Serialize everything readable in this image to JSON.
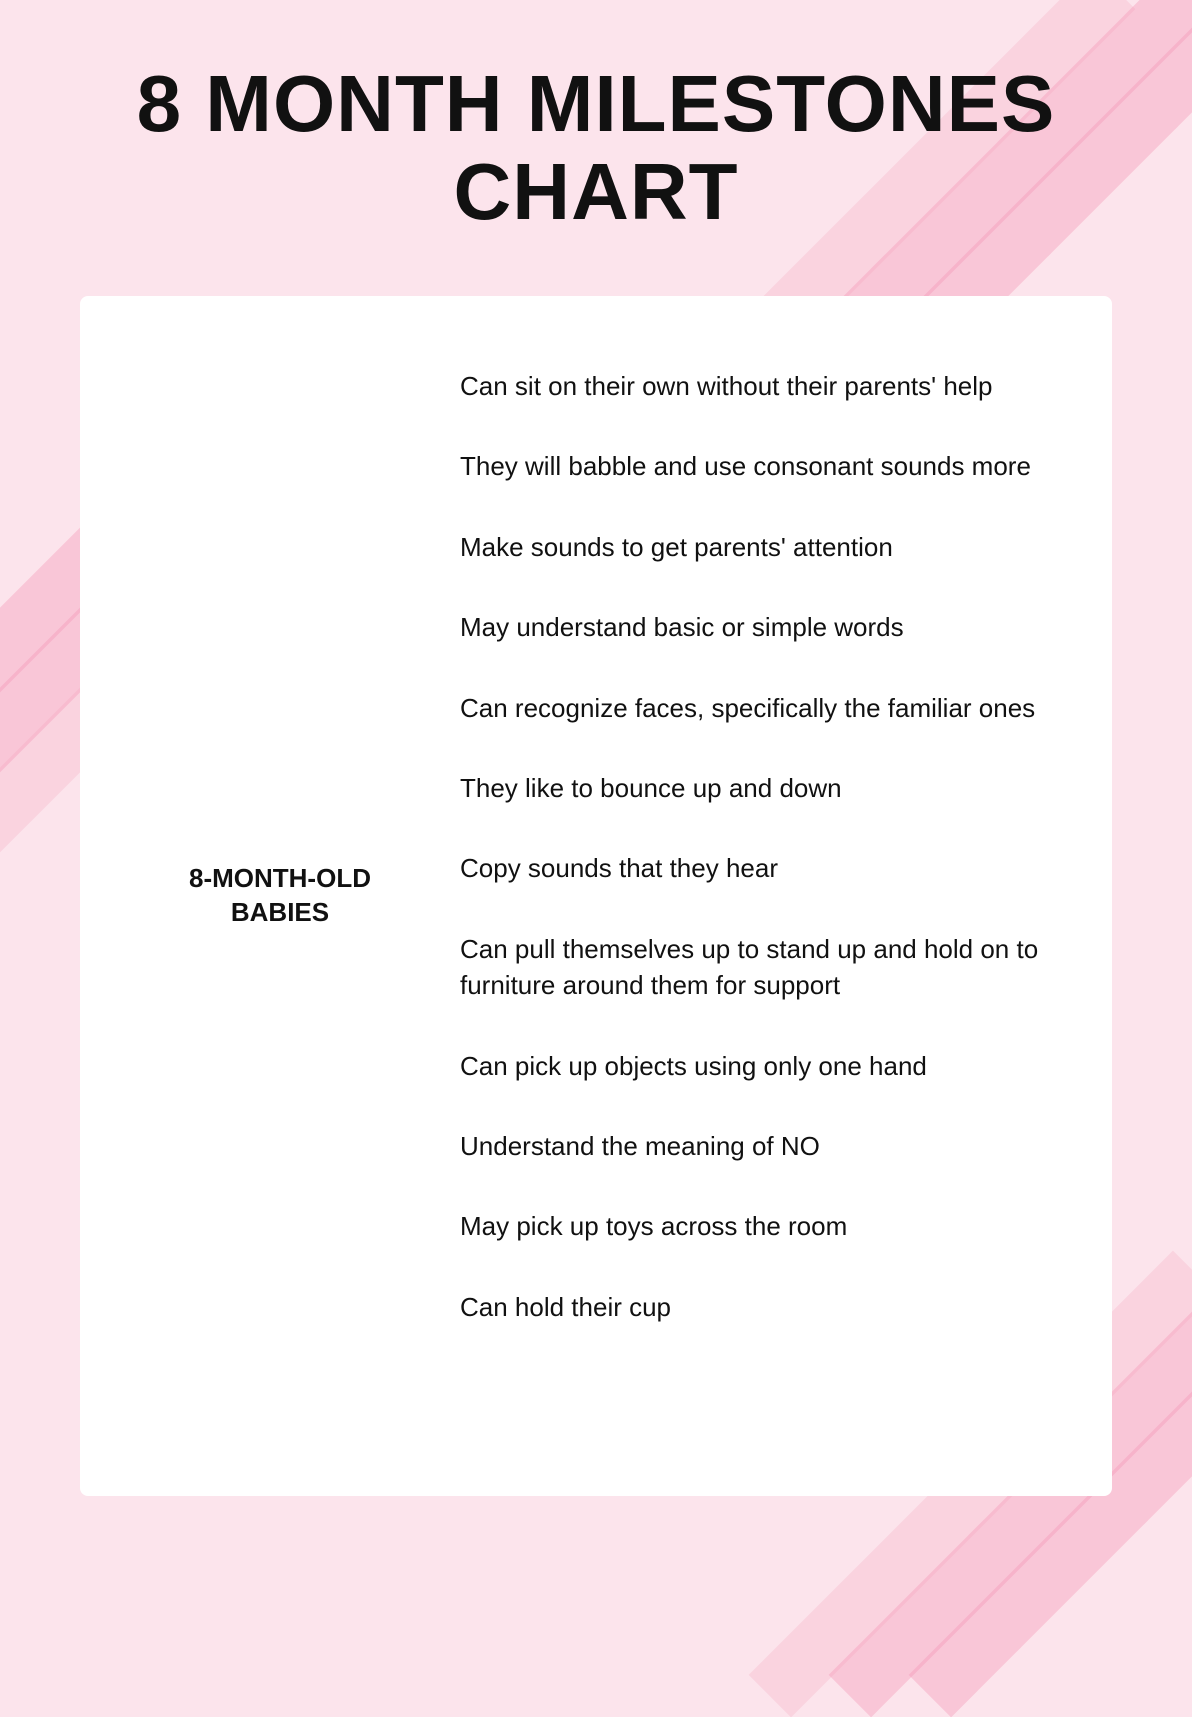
{
  "page": {
    "title_line1": "8 MONTH MILESTONES",
    "title_line2": "CHART",
    "background_color": "#fce4ec",
    "stripe_color": "#f48fb1"
  },
  "label": {
    "line1": "8-MONTH-OLD",
    "line2": "BABIES"
  },
  "milestones": [
    {
      "id": 1,
      "text": "Can sit on their own without their parents' help"
    },
    {
      "id": 2,
      "text": "They will babble and use consonant sounds more"
    },
    {
      "id": 3,
      "text": "Make sounds to get parents' attention"
    },
    {
      "id": 4,
      "text": "May understand basic or simple words"
    },
    {
      "id": 5,
      "text": "Can recognize faces, specifically the familiar ones"
    },
    {
      "id": 6,
      "text": "They like to bounce up and down"
    },
    {
      "id": 7,
      "text": "Copy sounds that they hear"
    },
    {
      "id": 8,
      "text": "Can pull themselves up to stand up and hold on to furniture around them for support"
    },
    {
      "id": 9,
      "text": "Can pick up objects using only one hand"
    },
    {
      "id": 10,
      "text": "Understand the meaning of NO"
    },
    {
      "id": 11,
      "text": "May pick up toys across the room"
    },
    {
      "id": 12,
      "text": "Can hold their cup"
    }
  ]
}
